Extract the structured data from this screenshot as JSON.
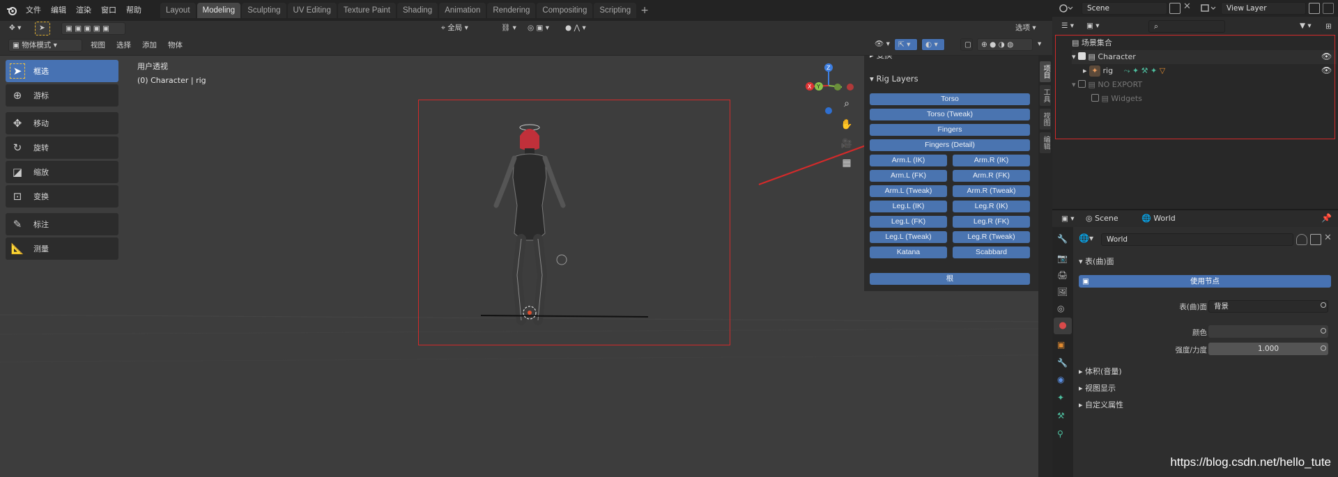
{
  "menubar": {
    "items": [
      "文件",
      "编辑",
      "渲染",
      "窗口",
      "帮助"
    ],
    "workspaces": [
      "Layout",
      "Modeling",
      "Sculpting",
      "UV Editing",
      "Texture Paint",
      "Shading",
      "Animation",
      "Rendering",
      "Compositing",
      "Scripting"
    ],
    "active_workspace": "Modeling",
    "add_symbol": "+"
  },
  "scene_selector": {
    "label": "Scene"
  },
  "view_layer_selector": {
    "label": "View Layer"
  },
  "viewport_header": {
    "mode": "物体模式",
    "menus": [
      "视图",
      "选择",
      "添加",
      "物体"
    ],
    "transform_orientation": "全局",
    "options_label": "选项"
  },
  "viewport": {
    "view_name": "用户透视",
    "active_object": "(0) Character | rig"
  },
  "toolbar": {
    "tools": [
      "框选",
      "游标",
      "移动",
      "旋转",
      "缩放",
      "变换",
      "标注",
      "测量"
    ]
  },
  "npanel": {
    "transform_section": "变换",
    "rig_layers_section": "Rig Layers",
    "full_buttons": [
      "Torso",
      "Torso (Tweak)",
      "Fingers",
      "Fingers (Detail)"
    ],
    "pair_buttons": [
      [
        "Arm.L (IK)",
        "Arm.R (IK)"
      ],
      [
        "Arm.L (FK)",
        "Arm.R (FK)"
      ],
      [
        "Arm.L (Tweak)",
        "Arm.R (Tweak)"
      ],
      [
        "Leg.L (IK)",
        "Leg.R (IK)"
      ],
      [
        "Leg.L (FK)",
        "Leg.R (FK)"
      ],
      [
        "Leg.L (Tweak)",
        "Leg.R (Tweak)"
      ],
      [
        "Katana",
        "Scabbard"
      ]
    ],
    "root_button": "根",
    "side_tabs": [
      "项目",
      "工具",
      "视图",
      "编辑"
    ]
  },
  "outliner": {
    "root": "场景集合",
    "items": [
      {
        "name": "Character",
        "type": "collection"
      },
      {
        "name": "rig",
        "type": "armature"
      },
      {
        "name": "NO EXPORT",
        "type": "collection"
      },
      {
        "name": "Widgets",
        "type": "collection"
      }
    ]
  },
  "properties": {
    "breadcrumb_scene": "Scene",
    "breadcrumb_world": "World",
    "world_name": "World",
    "surface_section": "表(曲)面",
    "use_nodes_button": "使用节点",
    "surface_label": "表(曲)面",
    "surface_value": "背景",
    "color_label": "颜色",
    "strength_label": "强度/力度",
    "strength_value": "1.000",
    "collapsed_sections": [
      "体积(音量)",
      "视图显示",
      "自定义属性"
    ]
  },
  "watermark": "https://blog.csdn.net/hello_tute",
  "colors": {
    "accent_blue": "#4772b3",
    "annotation_red": "#d42a2a",
    "character_head": "#c0303a"
  }
}
